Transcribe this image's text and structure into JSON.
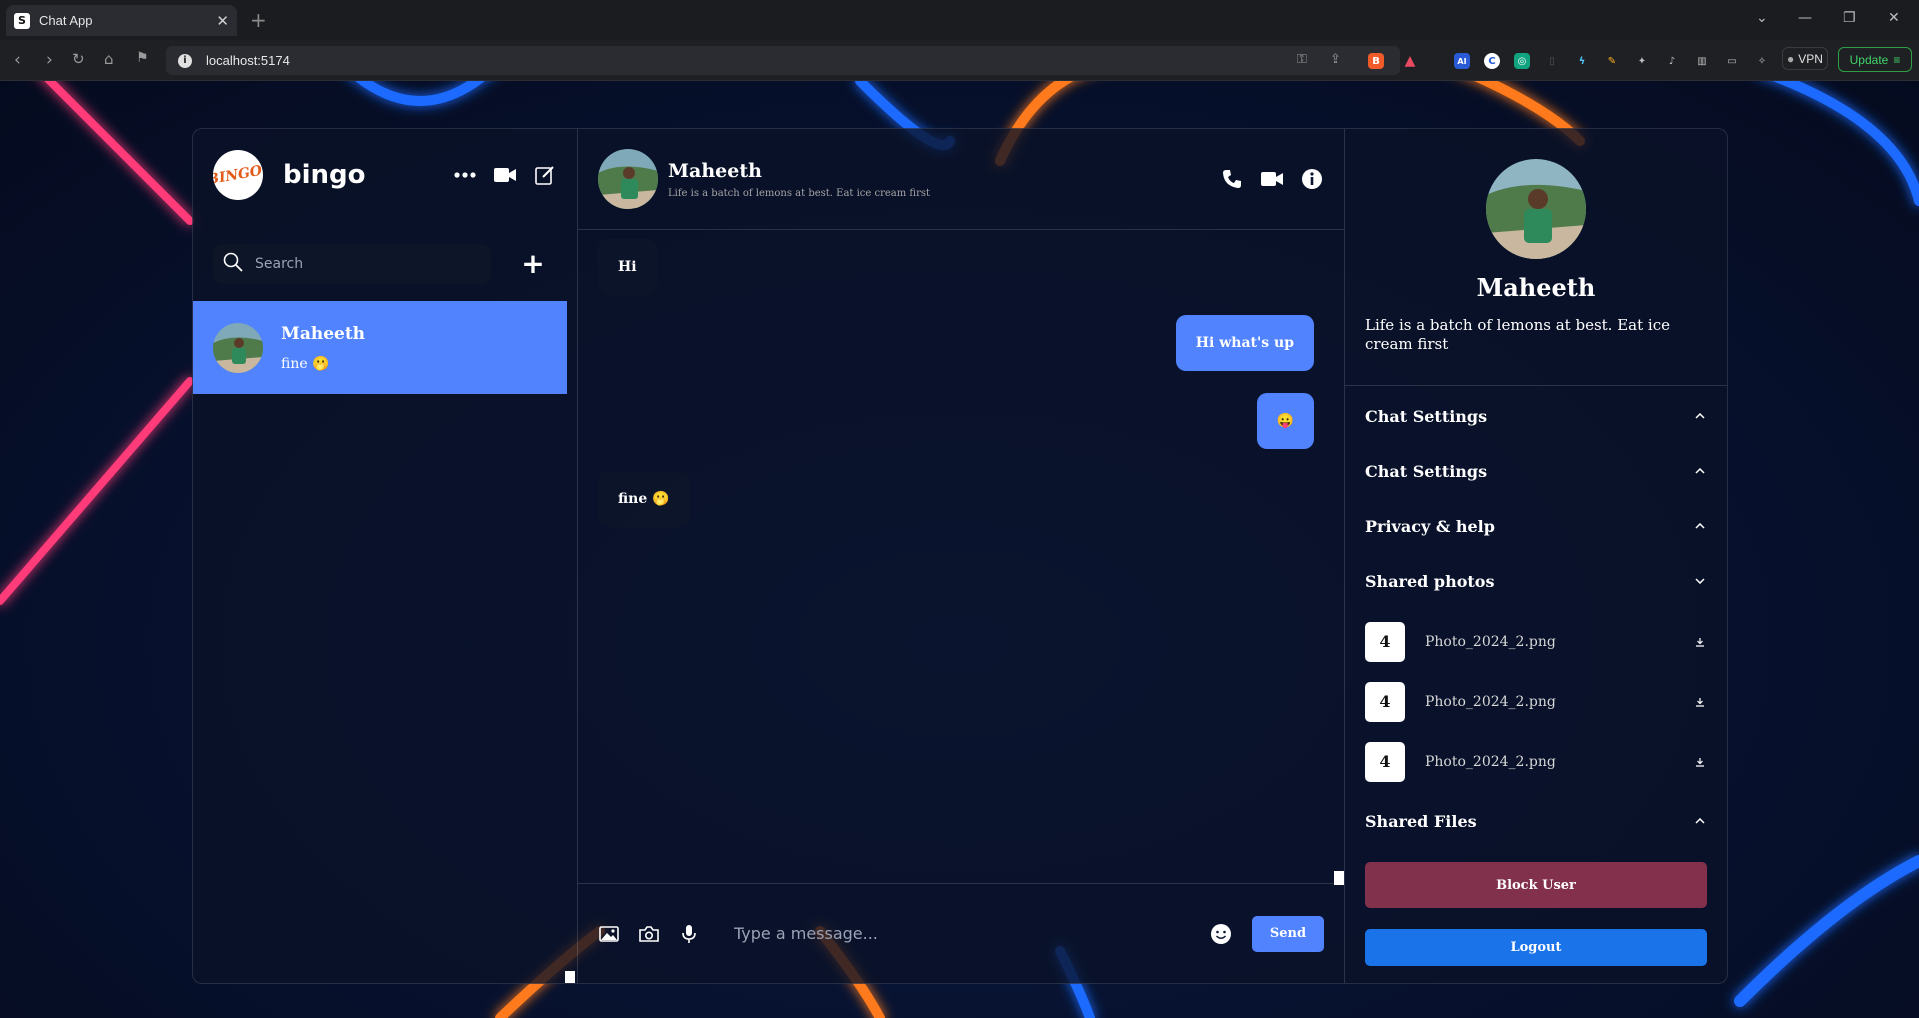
{
  "browser": {
    "tab_title": "Chat App",
    "tab_favicon": "S",
    "url": "localhost:5174",
    "vpn_label": "VPN",
    "update_label": "Update"
  },
  "user": {
    "name": "bingo",
    "logo_text": "BINGO!"
  },
  "chat_list": {
    "search_placeholder": "Search",
    "items": [
      {
        "name": "Maheeth",
        "last_message": "fine 🫢"
      }
    ]
  },
  "chat": {
    "name": "Maheeth",
    "status": "Life is a batch of lemons at best. Eat ice cream first",
    "messages": [
      {
        "text": "Hi",
        "own": false
      },
      {
        "text": "Hi what's up",
        "own": true
      },
      {
        "text": "😛",
        "own": true
      },
      {
        "text": "fine 🫢",
        "own": false
      }
    ],
    "input_placeholder": "Type a message...",
    "send_label": "Send"
  },
  "detail": {
    "name": "Maheeth",
    "status": "Life is a batch of lemons at best. Eat ice cream first",
    "options": [
      {
        "title": "Chat Settings",
        "expanded": false
      },
      {
        "title": "Chat Settings",
        "expanded": false
      },
      {
        "title": "Privacy & help",
        "expanded": false
      },
      {
        "title": "Shared photos",
        "expanded": true
      },
      {
        "title": "Shared Files",
        "expanded": false
      }
    ],
    "photos": [
      {
        "name": "Photo_2024_2.png"
      },
      {
        "name": "Photo_2024_2.png"
      },
      {
        "name": "Photo_2024_2.png"
      }
    ],
    "block_label": "Block User",
    "logout_label": "Logout"
  },
  "colors": {
    "accent": "#5183fe",
    "block": "#e64a69",
    "logout": "#1a73e8"
  }
}
